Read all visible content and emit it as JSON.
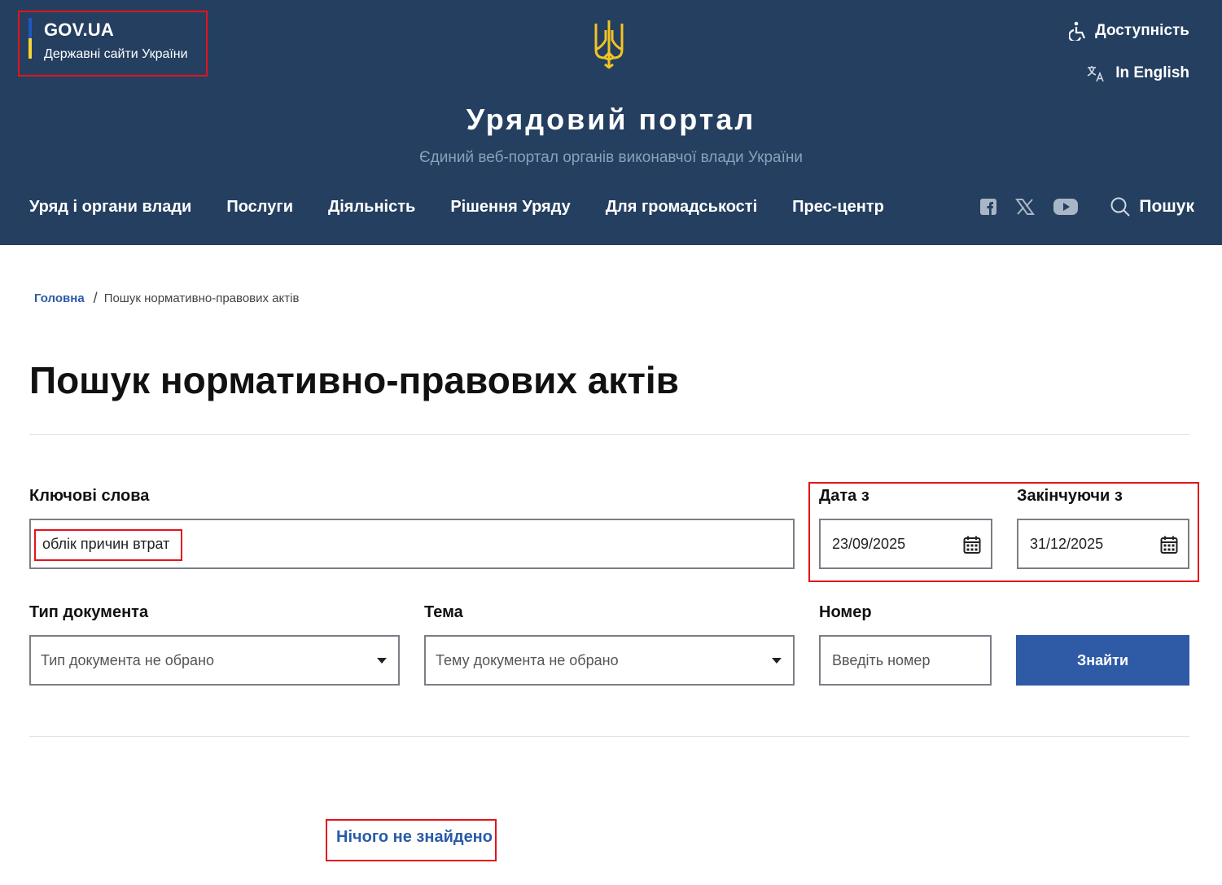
{
  "header": {
    "gov_title": "GOV.UA",
    "gov_subtitle": "Державні сайти України",
    "accessibility_label": "Доступність",
    "language_label": "In English",
    "portal_title": "Урядовий портал",
    "portal_subtitle": "Єдиний веб-портал органів виконавчої влади України",
    "nav": [
      {
        "label": "Уряд і органи влади"
      },
      {
        "label": "Послуги"
      },
      {
        "label": "Діяльність"
      },
      {
        "label": "Рішення Уряду"
      },
      {
        "label": "Для громадськості"
      },
      {
        "label": "Прес-центр"
      }
    ],
    "social": [
      "facebook-icon",
      "x-icon",
      "youtube-icon"
    ],
    "search_label": "Пошук",
    "colors": {
      "background": "#243f60",
      "flag_blue": "#1f57c3",
      "flag_yellow": "#f6d335"
    }
  },
  "breadcrumb": {
    "home": "Головна",
    "separator": "/",
    "current": "Пошук нормативно-правових актів"
  },
  "page": {
    "title": "Пошук нормативно-правових актів"
  },
  "form": {
    "keywords_label": "Ключові слова",
    "keywords_value": "облік причин втрат",
    "date_from_label": "Дата з",
    "date_from_value": "23/09/2025",
    "date_to_label": "Закінчуючи з",
    "date_to_value": "31/12/2025",
    "doc_type_label": "Тип документа",
    "doc_type_value": "Тип документа не обрано",
    "topic_label": "Тема",
    "topic_value": "Тему документа не обрано",
    "number_label": "Номер",
    "number_placeholder": "Введіть номер",
    "submit_label": "Знайти",
    "accent_color": "#2e5aa6"
  },
  "results": {
    "message": "Нічого не знайдено"
  }
}
